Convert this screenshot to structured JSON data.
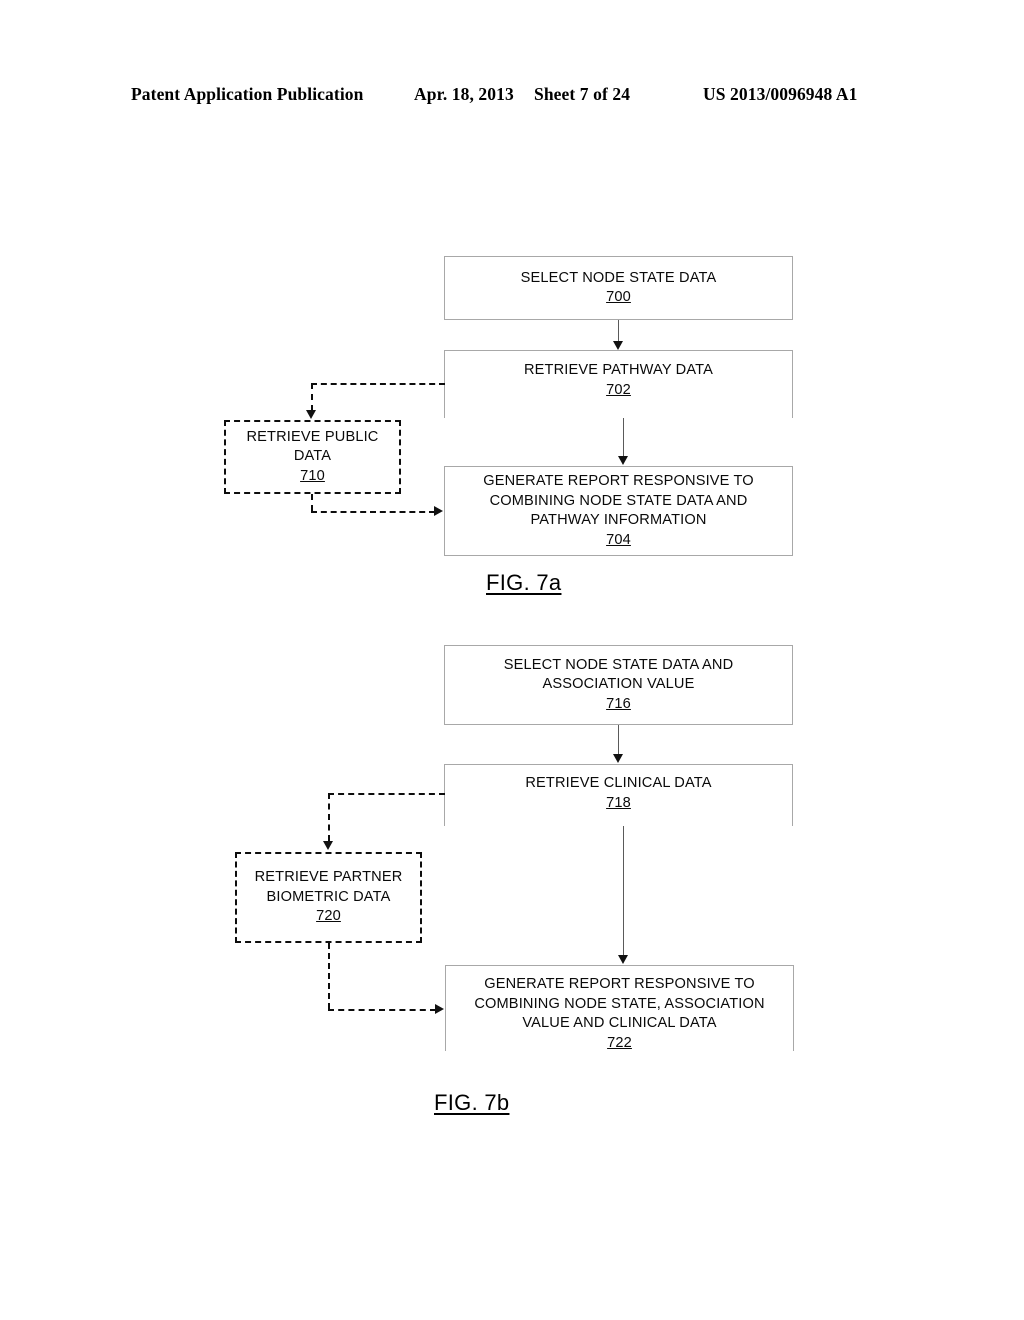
{
  "header": {
    "publication": "Patent Application Publication",
    "date": "Apr. 18, 2013",
    "sheet": "Sheet 7 of 24",
    "patent_number": "US 2013/0096948 A1"
  },
  "figures": [
    {
      "caption": "FIG. 7a",
      "boxes": [
        {
          "id": "700",
          "text": "SELECT NODE STATE DATA",
          "refnum": "700",
          "style": "solid"
        },
        {
          "id": "702",
          "text": "RETRIEVE PATHWAY DATA",
          "refnum": "702",
          "style": "solid"
        },
        {
          "id": "710",
          "text": "RETRIEVE PUBLIC\nDATA",
          "refnum": "710",
          "style": "dashed"
        },
        {
          "id": "704",
          "text": "GENERATE REPORT RESPONSIVE TO\nCOMBINING NODE STATE DATA AND\nPATHWAY INFORMATION",
          "refnum": "704",
          "style": "solid"
        }
      ],
      "connectors": [
        {
          "from": "700",
          "to": "702",
          "style": "solid"
        },
        {
          "from": "702",
          "to": "710",
          "style": "dashed"
        },
        {
          "from": "702",
          "to": "704",
          "style": "solid"
        },
        {
          "from": "710",
          "to": "704",
          "style": "dashed"
        }
      ]
    },
    {
      "caption": "FIG. 7b",
      "boxes": [
        {
          "id": "716",
          "text": "SELECT NODE STATE DATA AND\nASSOCIATION VALUE",
          "refnum": "716",
          "style": "solid"
        },
        {
          "id": "718",
          "text": "RETRIEVE CLINICAL DATA",
          "refnum": "718",
          "style": "solid"
        },
        {
          "id": "720",
          "text": "RETRIEVE PARTNER\nBIOMETRIC DATA",
          "refnum": "720",
          "style": "dashed"
        },
        {
          "id": "722",
          "text": "GENERATE REPORT RESPONSIVE TO\nCOMBINING NODE STATE, ASSOCIATION\nVALUE AND CLINICAL DATA",
          "refnum": "722",
          "style": "solid"
        }
      ],
      "connectors": [
        {
          "from": "716",
          "to": "718",
          "style": "solid"
        },
        {
          "from": "718",
          "to": "720",
          "style": "dashed"
        },
        {
          "from": "718",
          "to": "722",
          "style": "solid"
        },
        {
          "from": "720",
          "to": "722",
          "style": "dashed"
        }
      ]
    }
  ]
}
